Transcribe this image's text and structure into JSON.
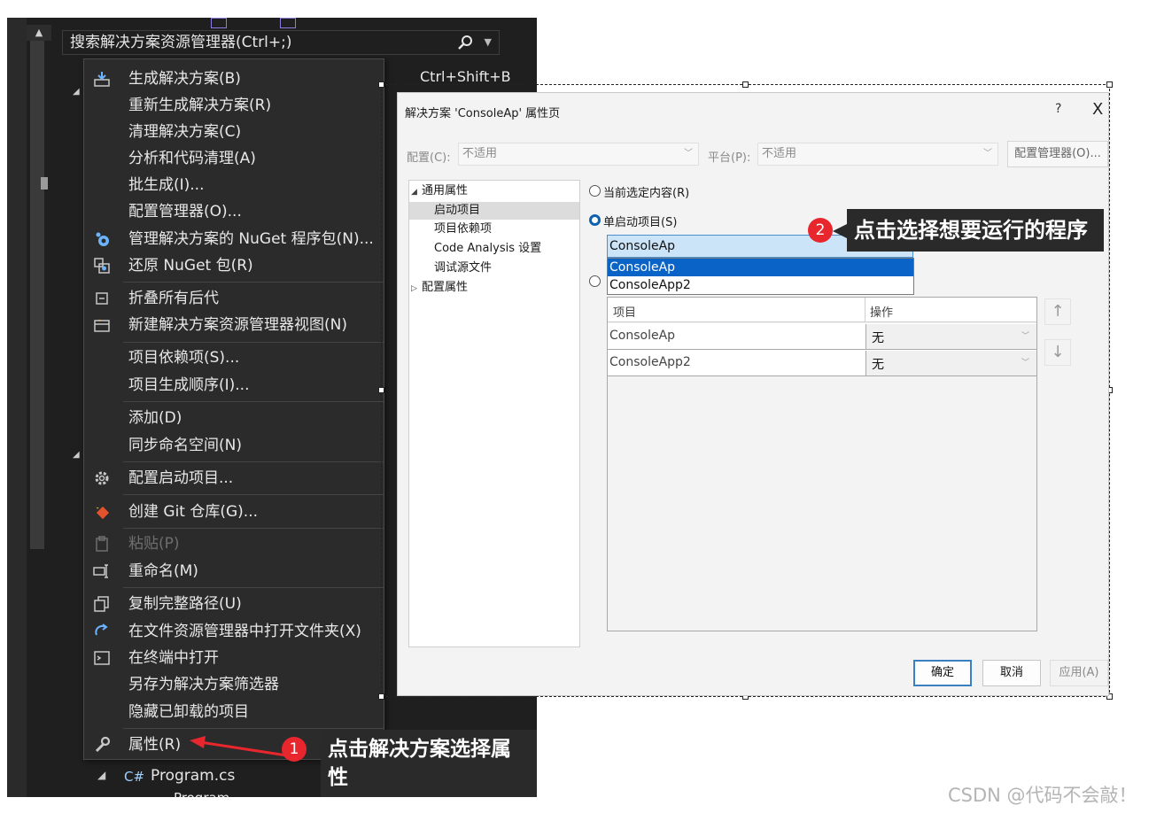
{
  "solution_explorer": {
    "search_placeholder": "搜索解决方案资源管理器(Ctrl+;)",
    "bottom_item": "Program.cs",
    "bottom_item_lang": "C#",
    "bottom_item_partial": "Program"
  },
  "context_menu": {
    "items": [
      {
        "label": "生成解决方案(B)",
        "shortcut": "Ctrl+Shift+B",
        "icon": "build-icon"
      },
      {
        "label": "重新生成解决方案(R)"
      },
      {
        "label": "清理解决方案(C)"
      },
      {
        "label": "分析和代码清理(A)"
      },
      {
        "label": "批生成(I)..."
      },
      {
        "label": "配置管理器(O)..."
      },
      {
        "label": "管理解决方案的 NuGet 程序包(N)...",
        "icon": "nuget-icon"
      },
      {
        "label": "还原 NuGet 包(R)",
        "icon": "restore-package-icon"
      },
      {
        "label": "折叠所有后代",
        "icon": "collapse-icon"
      },
      {
        "label": "新建解决方案资源管理器视图(N)",
        "icon": "new-view-icon"
      },
      {
        "label": "项目依赖项(S)..."
      },
      {
        "label": "项目生成顺序(I)..."
      },
      {
        "label": "添加(D)"
      },
      {
        "label": "同步命名空间(N)"
      },
      {
        "label": "配置启动项目...",
        "icon": "gear-icon"
      },
      {
        "label": "创建 Git 仓库(G)...",
        "icon": "git-icon"
      },
      {
        "label": "粘贴(P)",
        "icon": "paste-icon",
        "disabled": true
      },
      {
        "label": "重命名(M)",
        "icon": "rename-icon"
      },
      {
        "label": "复制完整路径(U)",
        "icon": "copy-icon"
      },
      {
        "label": "在文件资源管理器中打开文件夹(X)",
        "icon": "refresh-arrow-icon"
      },
      {
        "label": "在终端中打开",
        "icon": "terminal-icon"
      },
      {
        "label": "另存为解决方案筛选器"
      },
      {
        "label": "隐藏已卸载的项目"
      },
      {
        "label": "属性(R)",
        "icon": "wrench-icon"
      }
    ]
  },
  "dialog": {
    "title": "解决方案 'ConsoleAp' 属性页",
    "help": "?",
    "close": "X",
    "config_label": "配置(C):",
    "config_value": "不适用",
    "platform_label": "平台(P):",
    "platform_value": "不适用",
    "config_manager_button": "配置管理器(O)...",
    "tree": {
      "common_props": "通用属性",
      "startup_project": "启动项目",
      "project_dependencies": "项目依赖项",
      "code_analysis": "Code Analysis 设置",
      "debug_source": "调试源文件",
      "config_props": "配置属性"
    },
    "radio_current_selection": "当前选定内容(R)",
    "radio_single_startup": "单启动项目(S)",
    "combo_value": "ConsoleAp",
    "dropdown_options": [
      "ConsoleAp",
      "ConsoleApp2"
    ],
    "grid_headers": {
      "project": "项目",
      "action": "操作"
    },
    "grid_rows": [
      {
        "project": "ConsoleAp",
        "action": "无"
      },
      {
        "project": "ConsoleApp2",
        "action": "无"
      }
    ],
    "ok_button": "确定",
    "cancel_button": "取消",
    "apply_button": "应用(A)"
  },
  "annotations": {
    "step1_number": "1",
    "step1_text": "点击解决方案选择属性",
    "step2_number": "2",
    "step2_text": "点击选择想要运行的程序"
  },
  "watermark": "CSDN @代码不会敲！",
  "colors": {
    "vs_background": "#1f1f1f",
    "menu_background": "#2b2b2b",
    "dialog_background": "#f3f3f3",
    "selection_blue": "#0a64c8",
    "badge_red": "#e8262d",
    "callout_background": "#2a2a2a"
  }
}
